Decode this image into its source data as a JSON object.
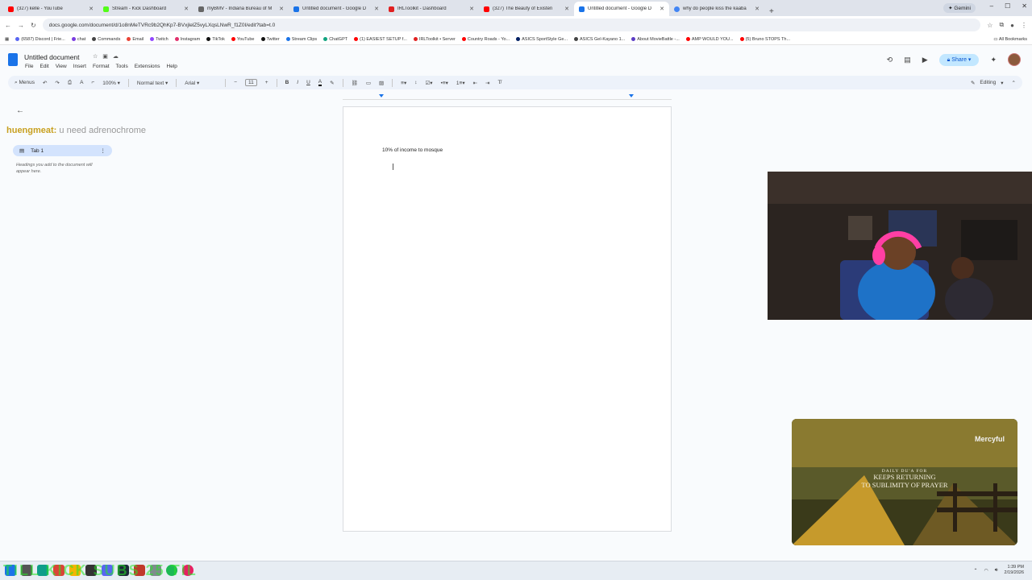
{
  "browser": {
    "tabs": [
      {
        "title": "(327) kelle - YouTube",
        "color": "#ff0000"
      },
      {
        "title": "Stream - Kick Dashboard",
        "color": "#53fc18"
      },
      {
        "title": "myBMV - Indiana Bureau of M",
        "color": "#666666"
      },
      {
        "title": "Untitled document - Google D",
        "color": "#1a73e8"
      },
      {
        "title": "IRLToolkit - Dashboard",
        "color": "#e02020"
      },
      {
        "title": "(327) The Beauty of Existen",
        "color": "#ff0000"
      },
      {
        "title": "Untitled document - Google D",
        "color": "#1a73e8",
        "active": true
      },
      {
        "title": "why do people kiss the kaaba",
        "color": "#4285f4"
      }
    ],
    "new_tab": "+",
    "gemini_label": "Gemini",
    "url": "docs.google.com/document/d/1o8nMeTVRc9b2QhKp7-BVxjlelZ5vyLXqsLNwR_f1Z0I/edit?tab=t.0",
    "bookmarks": [
      {
        "label": "(6587) Discord | Frie...",
        "color": "#5865f2"
      },
      {
        "label": "chat",
        "color": "#7a3ce0"
      },
      {
        "label": "Commands",
        "color": "#444444"
      },
      {
        "label": "Email",
        "color": "#ea4335"
      },
      {
        "label": "Twitch",
        "color": "#9146ff"
      },
      {
        "label": "Instagram",
        "color": "#e1306c"
      },
      {
        "label": "TikTok",
        "color": "#111111"
      },
      {
        "label": "YouTube",
        "color": "#ff0000"
      },
      {
        "label": "Twitter",
        "color": "#111111"
      },
      {
        "label": "Stream Clips",
        "color": "#1a73e8"
      },
      {
        "label": "ChatGPT",
        "color": "#10a37f"
      },
      {
        "label": "(1) EASIEST SETUP f...",
        "color": "#ff0000"
      },
      {
        "label": "IRLToolkit • Server",
        "color": "#e02020"
      },
      {
        "label": "Country Roads - Yo...",
        "color": "#ff0000"
      },
      {
        "label": "ASICS SportStyle Ge...",
        "color": "#001e62"
      },
      {
        "label": "ASICS Gel-Kayano 1...",
        "color": "#444444"
      },
      {
        "label": "About MovieBattle -...",
        "color": "#5b3cc4"
      },
      {
        "label": "AMP WOULD YOU...",
        "color": "#ff0000"
      },
      {
        "label": "(5) Bruno STOPS Th...",
        "color": "#ff0000"
      }
    ],
    "all_bookmarks": "All Bookmarks"
  },
  "docs": {
    "title": "Untitled document",
    "menus": [
      "File",
      "Edit",
      "View",
      "Insert",
      "Format",
      "Tools",
      "Extensions",
      "Help"
    ],
    "share_label": "Share",
    "toolbar": {
      "menus_label": "Menus",
      "zoom": "100%",
      "style": "Normal text",
      "font": "Arial",
      "font_size": "11",
      "editing_label": "Editing"
    },
    "outline": {
      "tab_label": "Tab 1",
      "hint": "Headings you add to the document will appear here."
    },
    "body_text": "10% of income to mosque"
  },
  "stream_overlay": {
    "chat_user": "huengmeat:",
    "chat_message": "u need adrenochrome",
    "subs_banner": "TILL KICK SUBS 25 TIL",
    "video_brand": "Mercyful",
    "video_caption_small": "DAILY DU'A FOR",
    "video_caption_line1": "KEEPS RETURNING",
    "video_caption_line2": "TO SUBLIMITY OF PRAYER"
  },
  "taskbar": {
    "time": "1:39 PM",
    "date": "2/19/2026"
  }
}
